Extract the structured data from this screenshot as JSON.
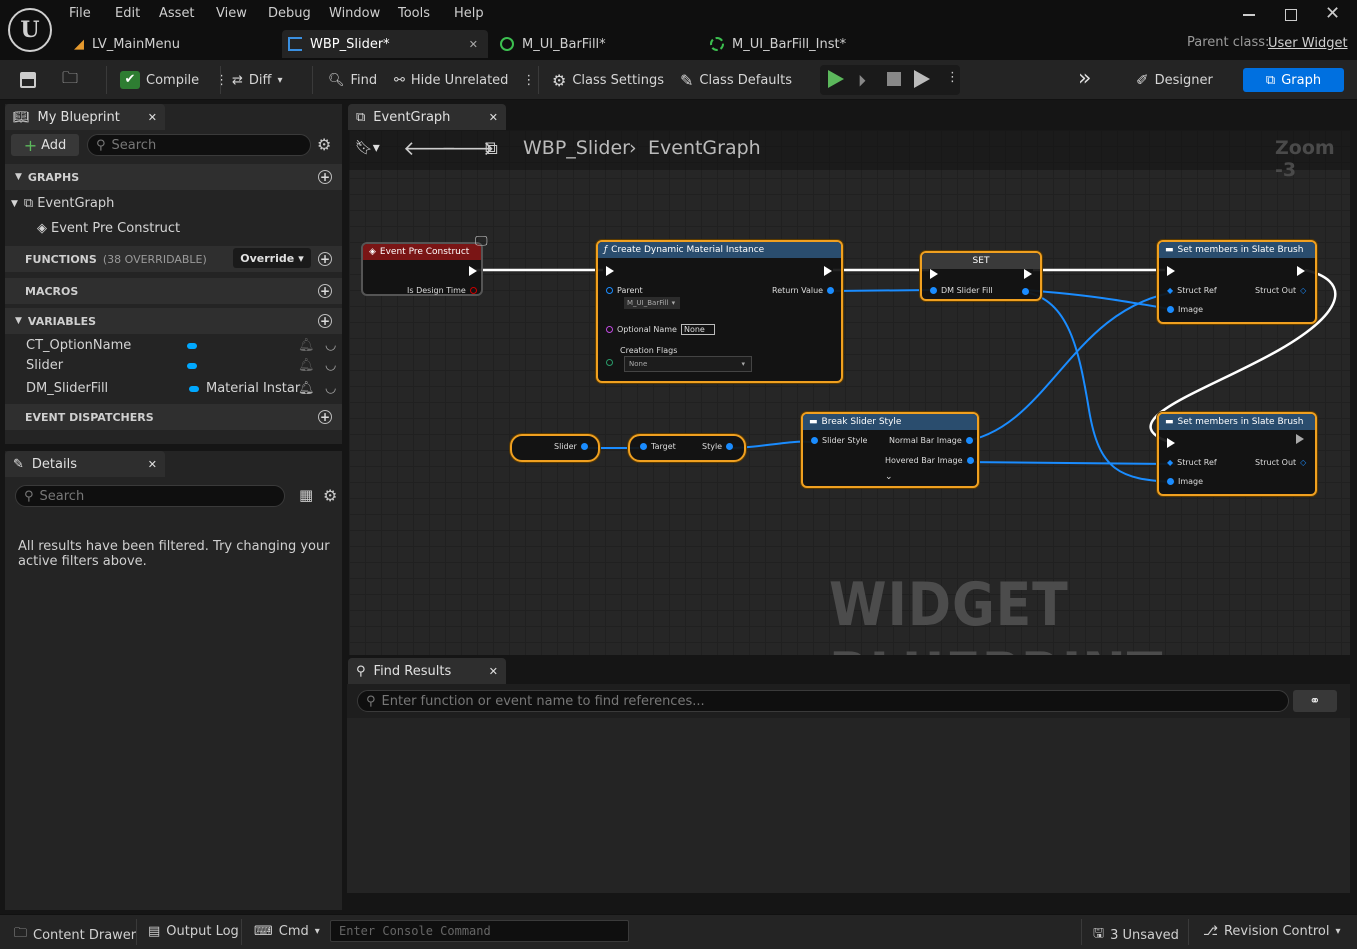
{
  "menu": [
    "File",
    "Edit",
    "Asset",
    "View",
    "Debug",
    "Window",
    "Tools",
    "Help"
  ],
  "tabs": [
    {
      "label": "LV_MainMenu"
    },
    {
      "label": "WBP_Slider*"
    },
    {
      "label": "M_UI_BarFill*"
    },
    {
      "label": "M_UI_BarFill_Inst*"
    }
  ],
  "parent_class": {
    "label": "Parent class:",
    "value": "User Widget"
  },
  "toolbar": {
    "compile": "Compile",
    "diff": "Diff",
    "find": "Find",
    "hide_unrelated": "Hide Unrelated",
    "class_settings": "Class Settings",
    "class_defaults": "Class Defaults",
    "designer": "Designer",
    "graph": "Graph"
  },
  "my_blueprint": {
    "title": "My Blueprint",
    "add": "Add",
    "search_placeholder": "Search",
    "graphs_header": "GRAPHS",
    "event_graph": "EventGraph",
    "event_pre_construct": "Event Pre Construct",
    "functions_header": "FUNCTIONS",
    "functions_count": "(38 OVERRIDABLE)",
    "override": "Override",
    "macros_header": "MACROS",
    "variables_header": "VARIABLES",
    "variables": [
      {
        "name": "CT_OptionName",
        "type": ""
      },
      {
        "name": "Slider",
        "type": ""
      },
      {
        "name": "DM_SliderFill",
        "type": "Material Instar"
      }
    ],
    "dispatchers_header": "EVENT DISPATCHERS"
  },
  "details": {
    "title": "Details",
    "search_placeholder": "Search",
    "empty_msg": "All results have been filtered. Try changing your active filters above."
  },
  "graph_tab": {
    "label": "EventGraph"
  },
  "breadcrumb": {
    "root": "WBP_Slider",
    "leaf": "EventGraph",
    "zoom": "Zoom -3"
  },
  "watermark": "WIDGET BLUEPRINT",
  "nodes": {
    "pre_construct": {
      "title": "Event Pre Construct",
      "pin": "Is Design Time"
    },
    "create_dmi": {
      "title": "Create Dynamic Material Instance",
      "parent": "Parent",
      "parent_val": "M_UI_BarFill",
      "optional_name": "Optional Name",
      "optional_val": "None",
      "flags": "Creation Flags",
      "flags_val": "None",
      "return": "Return Value"
    },
    "set": {
      "title": "SET",
      "pin": "DM Slider Fill"
    },
    "set_members_1": {
      "title": "Set members in Slate Brush",
      "struct_ref": "Struct Ref",
      "struct_out": "Struct Out",
      "image": "Image"
    },
    "set_members_2": {
      "title": "Set members in Slate Brush",
      "struct_ref": "Struct Ref",
      "struct_out": "Struct Out",
      "image": "Image"
    },
    "slider_get": {
      "label": "Slider"
    },
    "style_get": {
      "target": "Target",
      "style": "Style"
    },
    "break_style": {
      "title": "Break Slider Style",
      "in": "Slider Style",
      "normal": "Normal Bar Image",
      "hovered": "Hovered Bar Image"
    }
  },
  "find_results": {
    "title": "Find Results",
    "placeholder": "Enter function or event name to find references..."
  },
  "statusbar": {
    "content_drawer": "Content Drawer",
    "output_log": "Output Log",
    "cmd": "Cmd",
    "console_placeholder": "Enter Console Command",
    "unsaved": "3 Unsaved",
    "revision": "Revision Control"
  },
  "colors": {
    "accent": "#0070e0",
    "node_border": "#f0a020",
    "pin_blue": "#1a8cff",
    "event_red": "#8b1a1a"
  }
}
